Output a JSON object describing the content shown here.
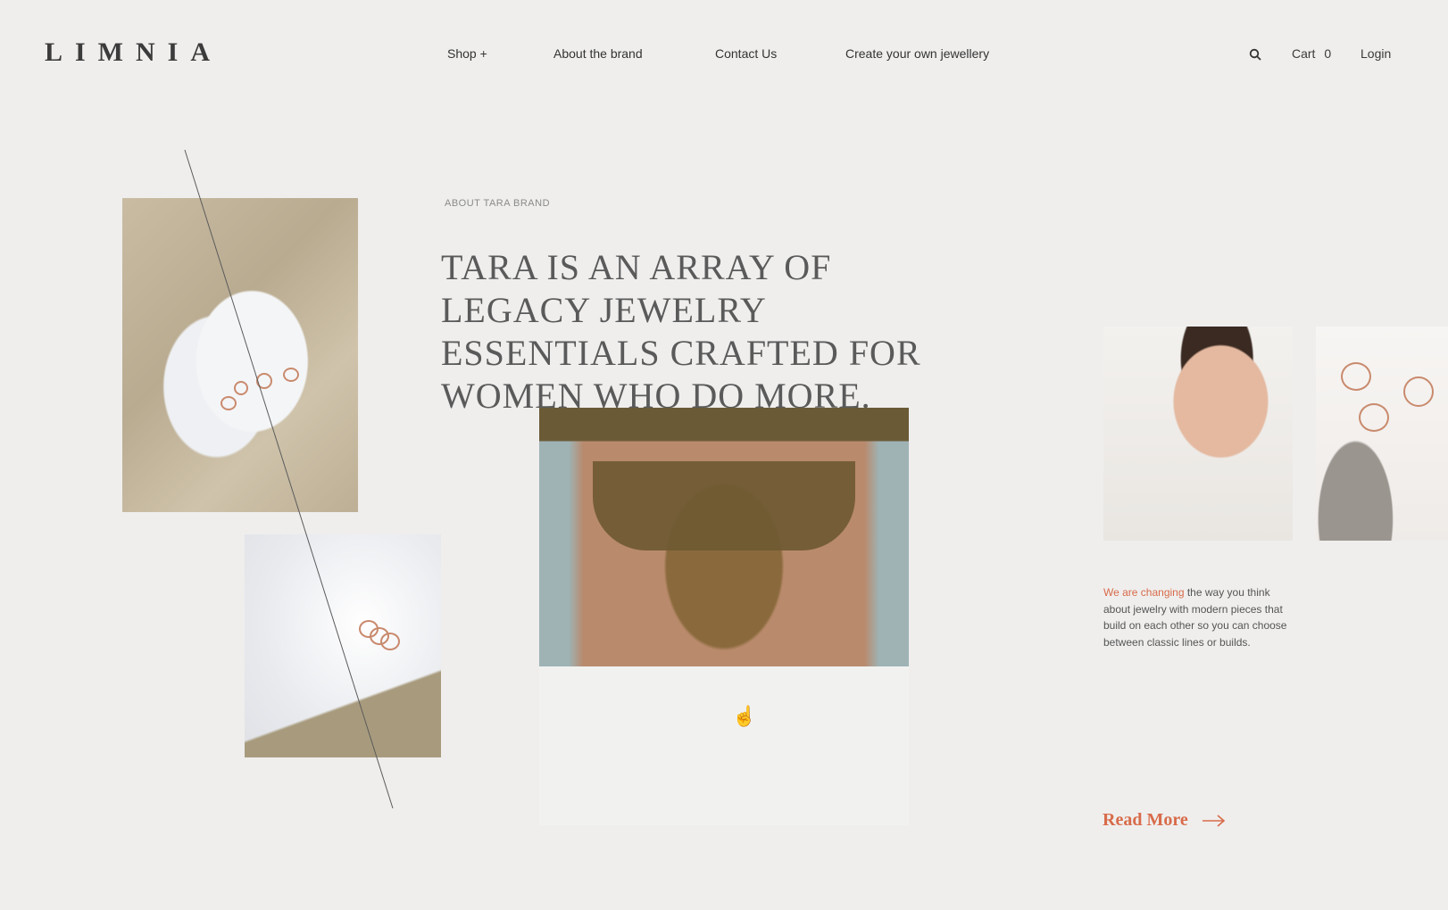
{
  "header": {
    "logo": "LIMNIA",
    "nav": [
      "Shop +",
      "About the brand",
      "Contact Us",
      "Create your own jewellery"
    ],
    "cart_label": "Cart",
    "cart_count": "0",
    "login": "Login",
    "search_icon": "search-icon"
  },
  "hero": {
    "eyebrow": "ABOUT TARA BRAND",
    "headline": "TARA IS AN ARRAY OF LEGACY JEWELRY ESSENTIALS CRAFTED FOR WOMEN WHO DO MORE."
  },
  "side": {
    "desc_accent": "We are changing",
    "desc_rest": " the way you think about jewelry with modern pieces that build on each other so you can choose between classic lines or builds.",
    "read_more": "Read More",
    "arrow_icon": "arrow-right-icon"
  },
  "colors": {
    "background": "#efeeed",
    "accent": "#d86b4a"
  }
}
